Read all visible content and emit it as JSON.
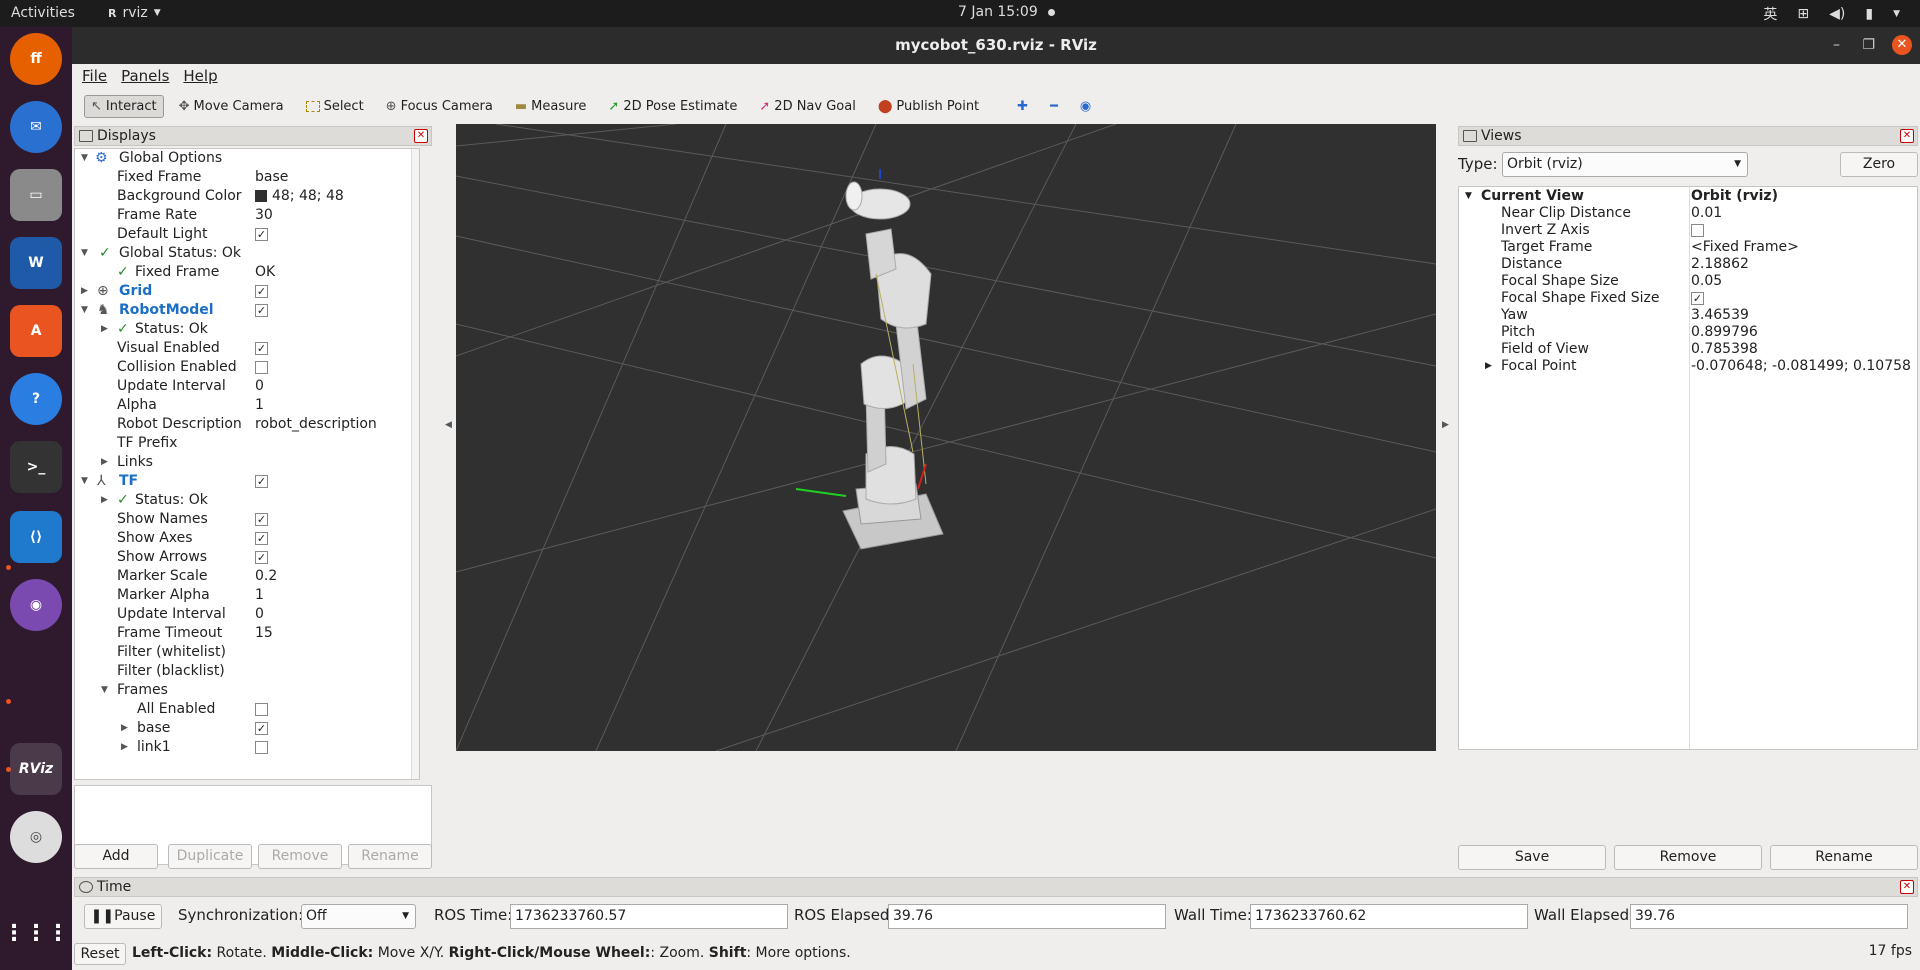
{
  "topbar": {
    "activities": "Activities",
    "app_name": "rviz",
    "clock": "7 Jan  15:09",
    "lang": "英"
  },
  "window": {
    "title": "mycobot_630.rviz - RViz"
  },
  "menu": [
    "File",
    "Panels",
    "Help"
  ],
  "toolbar": {
    "interact": "Interact",
    "move_camera": "Move Camera",
    "select": "Select",
    "focus_camera": "Focus Camera",
    "measure": "Measure",
    "pose_estimate": "2D Pose Estimate",
    "nav_goal": "2D Nav Goal",
    "publish_point": "Publish Point"
  },
  "displays": {
    "title": "Displays",
    "rows": [
      {
        "name": "Global Options",
        "value": ""
      },
      {
        "name": "Fixed Frame",
        "value": "base"
      },
      {
        "name": "Background Color",
        "value": "48; 48; 48"
      },
      {
        "name": "Frame Rate",
        "value": "30"
      },
      {
        "name": "Default Light",
        "value": ""
      },
      {
        "name": "Global Status: Ok",
        "value": ""
      },
      {
        "name": "Fixed Frame",
        "value": "OK"
      },
      {
        "name": "Grid",
        "value": ""
      },
      {
        "name": "RobotModel",
        "value": ""
      },
      {
        "name": "Status: Ok",
        "value": ""
      },
      {
        "name": "Visual Enabled",
        "value": ""
      },
      {
        "name": "Collision Enabled",
        "value": ""
      },
      {
        "name": "Update Interval",
        "value": "0"
      },
      {
        "name": "Alpha",
        "value": "1"
      },
      {
        "name": "Robot Description",
        "value": "robot_description"
      },
      {
        "name": "TF Prefix",
        "value": ""
      },
      {
        "name": "Links",
        "value": ""
      },
      {
        "name": "TF",
        "value": ""
      },
      {
        "name": "Status: Ok",
        "value": ""
      },
      {
        "name": "Show Names",
        "value": ""
      },
      {
        "name": "Show Axes",
        "value": ""
      },
      {
        "name": "Show Arrows",
        "value": ""
      },
      {
        "name": "Marker Scale",
        "value": "0.2"
      },
      {
        "name": "Marker Alpha",
        "value": "1"
      },
      {
        "name": "Update Interval",
        "value": "0"
      },
      {
        "name": "Frame Timeout",
        "value": "15"
      },
      {
        "name": "Filter (whitelist)",
        "value": ""
      },
      {
        "name": "Filter (blacklist)",
        "value": ""
      },
      {
        "name": "Frames",
        "value": ""
      },
      {
        "name": "All Enabled",
        "value": ""
      },
      {
        "name": "base",
        "value": ""
      },
      {
        "name": "link1",
        "value": ""
      }
    ],
    "buttons": {
      "add": "Add",
      "duplicate": "Duplicate",
      "remove": "Remove",
      "rename": "Rename"
    },
    "background_color": "#303030"
  },
  "views": {
    "title": "Views",
    "type_label": "Type:",
    "type_value": "Orbit (rviz)",
    "zero": "Zero",
    "current_view": {
      "name": "Current View",
      "value": "Orbit (rviz)"
    },
    "rows": [
      {
        "name": "Near Clip Distance",
        "value": "0.01"
      },
      {
        "name": "Invert Z Axis",
        "value": ""
      },
      {
        "name": "Target Frame",
        "value": "<Fixed Frame>"
      },
      {
        "name": "Distance",
        "value": "2.18862"
      },
      {
        "name": "Focal Shape Size",
        "value": "0.05"
      },
      {
        "name": "Focal Shape Fixed Size",
        "value": ""
      },
      {
        "name": "Yaw",
        "value": "3.46539"
      },
      {
        "name": "Pitch",
        "value": "0.899796"
      },
      {
        "name": "Field of View",
        "value": "0.785398"
      },
      {
        "name": "Focal Point",
        "value": "-0.070648; -0.081499; 0.10758"
      }
    ],
    "buttons": {
      "save": "Save",
      "remove": "Remove",
      "rename": "Rename"
    }
  },
  "time": {
    "title": "Time",
    "pause": "Pause",
    "sync_label": "Synchronization:",
    "sync_value": "Off",
    "ros_time_label": "ROS Time:",
    "ros_time": "1736233760.57",
    "ros_elapsed_label": "ROS Elapsed:",
    "ros_elapsed": "39.76",
    "wall_time_label": "Wall Time:",
    "wall_time": "1736233760.62",
    "wall_elapsed_label": "Wall Elapsed:",
    "wall_elapsed": "39.76"
  },
  "status": {
    "reset": "Reset",
    "left_click": "Left-Click:",
    "left_desc": " Rotate. ",
    "middle_click": "Middle-Click:",
    "middle_desc": " Move X/Y. ",
    "right_click": "Right-Click/Mouse Wheel:",
    "right_desc": ": Zoom. ",
    "shift": "Shift",
    "shift_desc": ": More options.",
    "fps": "17 fps"
  }
}
